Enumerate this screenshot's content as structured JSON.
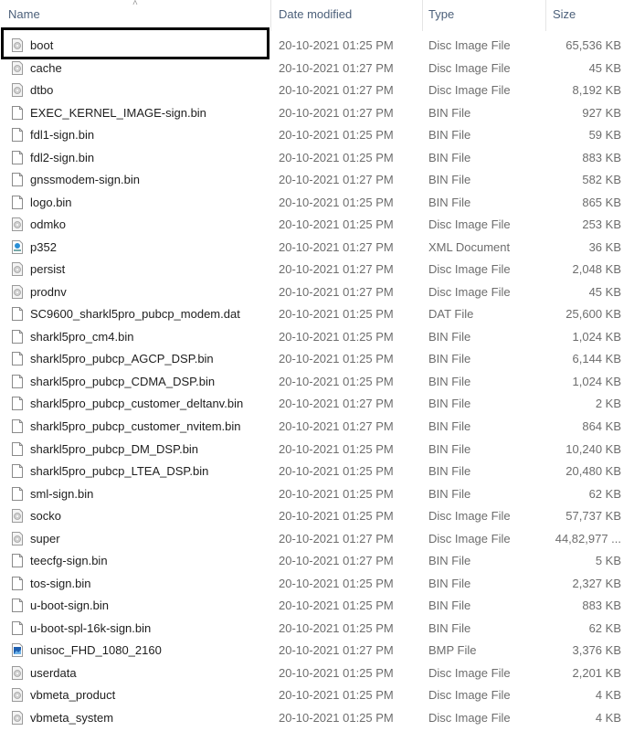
{
  "header": {
    "name": "Name",
    "date": "Date modified",
    "type": "Type",
    "size": "Size",
    "sort_icon": "chevron-up-icon"
  },
  "files": [
    {
      "name": "boot",
      "date": "20-10-2021 01:25 PM",
      "type": "Disc Image File",
      "size": "65,536 KB",
      "icon": "disc",
      "selected": true
    },
    {
      "name": "cache",
      "date": "20-10-2021 01:27 PM",
      "type": "Disc Image File",
      "size": "45 KB",
      "icon": "disc"
    },
    {
      "name": "dtbo",
      "date": "20-10-2021 01:27 PM",
      "type": "Disc Image File",
      "size": "8,192 KB",
      "icon": "disc"
    },
    {
      "name": "EXEC_KERNEL_IMAGE-sign.bin",
      "date": "20-10-2021 01:27 PM",
      "type": "BIN File",
      "size": "927 KB",
      "icon": "file"
    },
    {
      "name": "fdl1-sign.bin",
      "date": "20-10-2021 01:25 PM",
      "type": "BIN File",
      "size": "59 KB",
      "icon": "file"
    },
    {
      "name": "fdl2-sign.bin",
      "date": "20-10-2021 01:25 PM",
      "type": "BIN File",
      "size": "883 KB",
      "icon": "file"
    },
    {
      "name": "gnssmodem-sign.bin",
      "date": "20-10-2021 01:27 PM",
      "type": "BIN File",
      "size": "582 KB",
      "icon": "file"
    },
    {
      "name": "logo.bin",
      "date": "20-10-2021 01:25 PM",
      "type": "BIN File",
      "size": "865 KB",
      "icon": "file"
    },
    {
      "name": "odmko",
      "date": "20-10-2021 01:25 PM",
      "type": "Disc Image File",
      "size": "253 KB",
      "icon": "disc"
    },
    {
      "name": "p352",
      "date": "20-10-2021 01:27 PM",
      "type": "XML Document",
      "size": "36 KB",
      "icon": "xml"
    },
    {
      "name": "persist",
      "date": "20-10-2021 01:27 PM",
      "type": "Disc Image File",
      "size": "2,048 KB",
      "icon": "disc"
    },
    {
      "name": "prodnv",
      "date": "20-10-2021 01:27 PM",
      "type": "Disc Image File",
      "size": "45 KB",
      "icon": "disc"
    },
    {
      "name": "SC9600_sharkl5pro_pubcp_modem.dat",
      "date": "20-10-2021 01:25 PM",
      "type": "DAT File",
      "size": "25,600 KB",
      "icon": "file"
    },
    {
      "name": "sharkl5pro_cm4.bin",
      "date": "20-10-2021 01:25 PM",
      "type": "BIN File",
      "size": "1,024 KB",
      "icon": "file"
    },
    {
      "name": "sharkl5pro_pubcp_AGCP_DSP.bin",
      "date": "20-10-2021 01:25 PM",
      "type": "BIN File",
      "size": "6,144 KB",
      "icon": "file"
    },
    {
      "name": "sharkl5pro_pubcp_CDMA_DSP.bin",
      "date": "20-10-2021 01:25 PM",
      "type": "BIN File",
      "size": "1,024 KB",
      "icon": "file"
    },
    {
      "name": "sharkl5pro_pubcp_customer_deltanv.bin",
      "date": "20-10-2021 01:27 PM",
      "type": "BIN File",
      "size": "2 KB",
      "icon": "file"
    },
    {
      "name": "sharkl5pro_pubcp_customer_nvitem.bin",
      "date": "20-10-2021 01:27 PM",
      "type": "BIN File",
      "size": "864 KB",
      "icon": "file"
    },
    {
      "name": "sharkl5pro_pubcp_DM_DSP.bin",
      "date": "20-10-2021 01:25 PM",
      "type": "BIN File",
      "size": "10,240 KB",
      "icon": "file"
    },
    {
      "name": "sharkl5pro_pubcp_LTEA_DSP.bin",
      "date": "20-10-2021 01:25 PM",
      "type": "BIN File",
      "size": "20,480 KB",
      "icon": "file"
    },
    {
      "name": "sml-sign.bin",
      "date": "20-10-2021 01:25 PM",
      "type": "BIN File",
      "size": "62 KB",
      "icon": "file"
    },
    {
      "name": "socko",
      "date": "20-10-2021 01:25 PM",
      "type": "Disc Image File",
      "size": "57,737 KB",
      "icon": "disc"
    },
    {
      "name": "super",
      "date": "20-10-2021 01:27 PM",
      "type": "Disc Image File",
      "size": "44,82,977 ...",
      "icon": "disc"
    },
    {
      "name": "teecfg-sign.bin",
      "date": "20-10-2021 01:27 PM",
      "type": "BIN File",
      "size": "5 KB",
      "icon": "file"
    },
    {
      "name": "tos-sign.bin",
      "date": "20-10-2021 01:25 PM",
      "type": "BIN File",
      "size": "2,327 KB",
      "icon": "file"
    },
    {
      "name": "u-boot-sign.bin",
      "date": "20-10-2021 01:25 PM",
      "type": "BIN File",
      "size": "883 KB",
      "icon": "file"
    },
    {
      "name": "u-boot-spl-16k-sign.bin",
      "date": "20-10-2021 01:25 PM",
      "type": "BIN File",
      "size": "62 KB",
      "icon": "file"
    },
    {
      "name": "unisoc_FHD_1080_2160",
      "date": "20-10-2021 01:27 PM",
      "type": "BMP File",
      "size": "3,376 KB",
      "icon": "bmp"
    },
    {
      "name": "userdata",
      "date": "20-10-2021 01:25 PM",
      "type": "Disc Image File",
      "size": "2,201 KB",
      "icon": "disc"
    },
    {
      "name": "vbmeta_product",
      "date": "20-10-2021 01:25 PM",
      "type": "Disc Image File",
      "size": "4 KB",
      "icon": "disc"
    },
    {
      "name": "vbmeta_system",
      "date": "20-10-2021 01:25 PM",
      "type": "Disc Image File",
      "size": "4 KB",
      "icon": "disc"
    }
  ]
}
